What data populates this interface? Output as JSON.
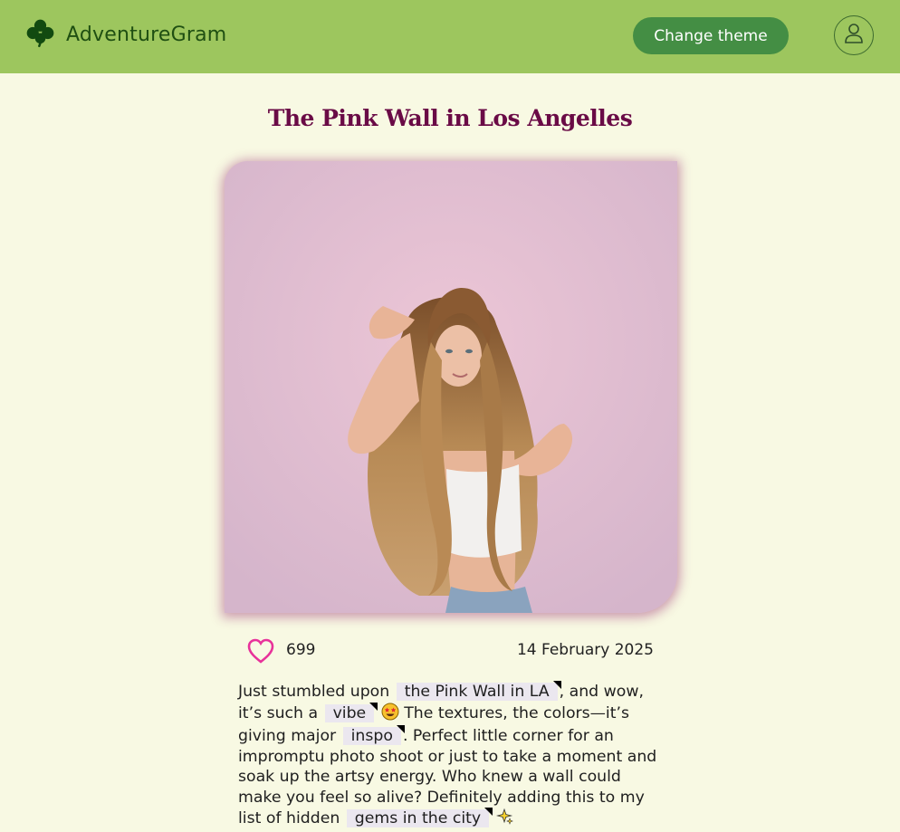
{
  "header": {
    "app_name": "AdventureGram",
    "logo_icon": "clover-icon",
    "theme_button_label": "Change theme",
    "profile_icon": "user-icon",
    "bar_color": "#9dc65e",
    "button_color": "#448e44"
  },
  "post": {
    "title": "The Pink Wall in Los Angelles",
    "image_alt": "Woman with long wavy hair posing in front of a pink wall",
    "likes": "699",
    "date": "14 February 2025",
    "caption": {
      "p1": "Just stumbled upon ",
      "tag1": "the Pink Wall in LA",
      "p2": ", and wow, it’s such a ",
      "tag2": "vibe",
      "emoji1": "star-struck-emoji",
      "p3": " The textures, the colors—it’s giving major ",
      "tag3": "inspo",
      "p4": ". Perfect little corner for an impromptu photo shoot or just to take a moment and soak up the artsy energy. Who knew a wall could make you feel so alive? Definitely adding this to my list of hidden ",
      "tag4": "gems in the city",
      "emoji2": "sparkles-emoji"
    },
    "title_color": "#6a0b46",
    "heart_color": "#e8329a"
  }
}
